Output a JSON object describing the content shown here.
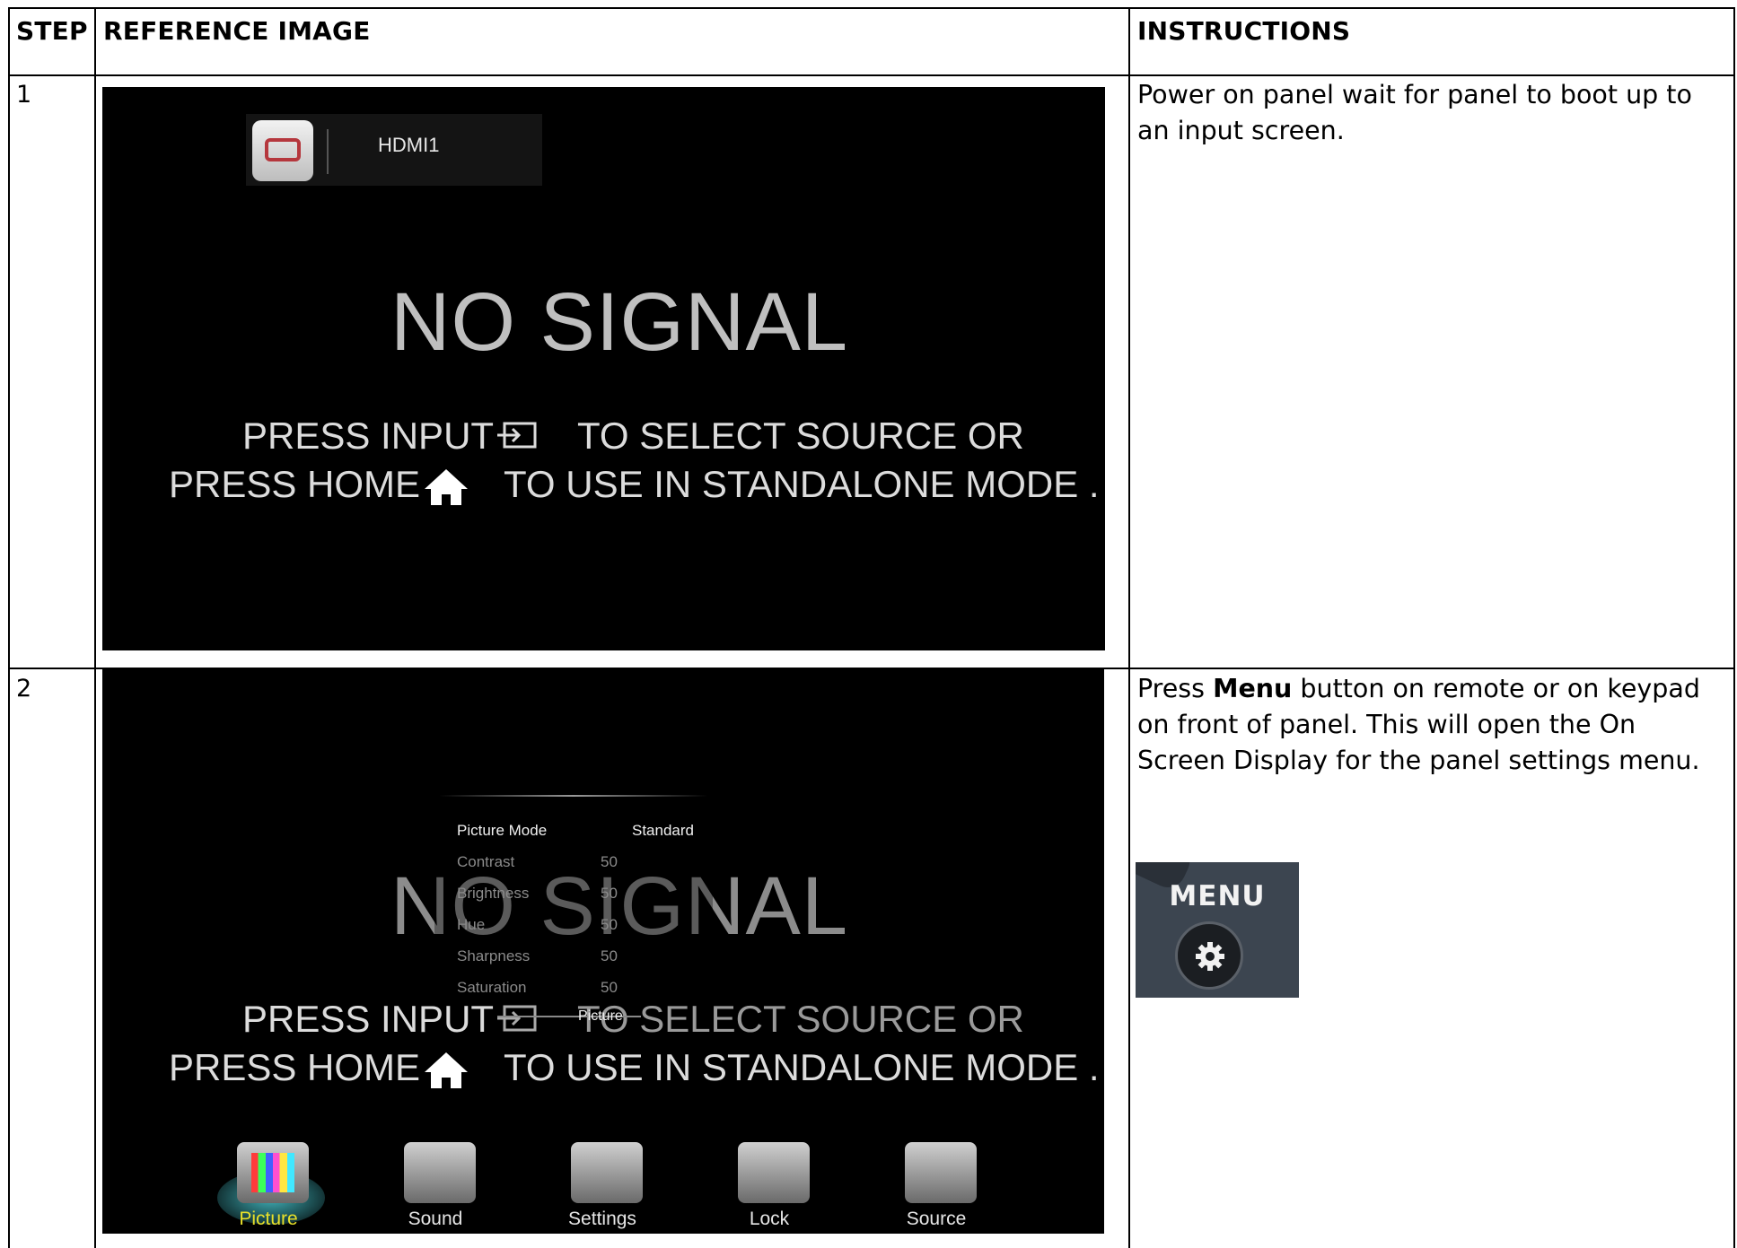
{
  "headers": {
    "step": "STEP",
    "reference": "REFERENCE IMAGE",
    "instructions": "INSTRUCTIONS"
  },
  "rows": [
    {
      "step": "1",
      "screen": {
        "source_label": "HDMI1",
        "no_signal": "NO SIGNAL",
        "line1_a": "PRESS INPUT",
        "line1_b": "TO SELECT SOURCE OR",
        "line2_a": "PRESS HOME",
        "line2_b": "TO USE IN STANDALONE MODE ."
      },
      "instruction": "Power on panel wait for panel to boot up to an input screen."
    },
    {
      "step": "2",
      "screen": {
        "no_signal": "NO SIGNAL",
        "line1_a": "PRESS INPUT",
        "line1_b": "TO SELECT SOURCE OR",
        "line2_a": "PRESS HOME",
        "line2_b": "TO USE IN STANDALONE MODE .",
        "osd": {
          "rows": [
            {
              "label": "Picture Mode",
              "value": "Standard"
            },
            {
              "label": "Contrast",
              "value": "50"
            },
            {
              "label": "Brightness",
              "value": "50"
            },
            {
              "label": "Hue",
              "value": "50"
            },
            {
              "label": "Sharpness",
              "value": "50"
            },
            {
              "label": "Saturation",
              "value": "50"
            }
          ],
          "caption": "Picture"
        },
        "tabs": [
          "Picture",
          "Sound",
          "Settings",
          "Lock",
          "Source"
        ]
      },
      "instruction_pre": "Press ",
      "instruction_bold": "Menu",
      "instruction_post": " button on remote or on keypad on front of panel.  This will open the On Screen Display for the panel settings menu.",
      "photo_caption": "MENU"
    }
  ],
  "colors": {
    "active_tab": "#e8e02a",
    "screen_bg": "#000000"
  }
}
